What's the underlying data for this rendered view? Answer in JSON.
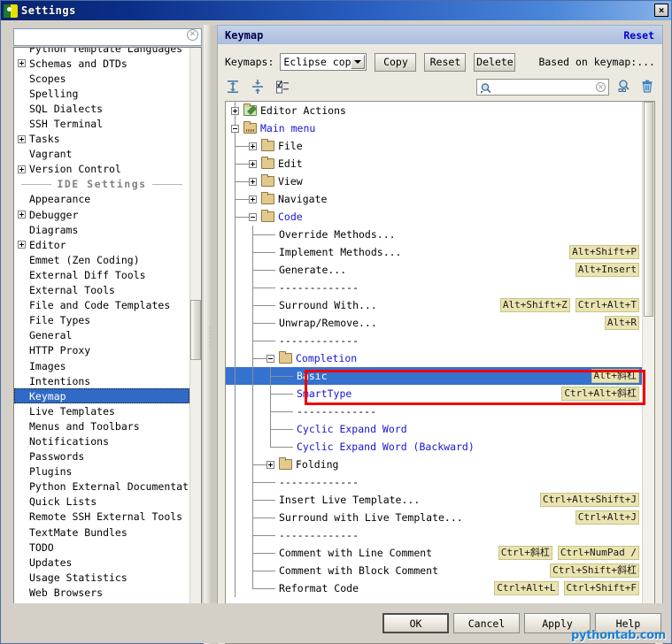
{
  "window": {
    "title": "Settings",
    "close_label": "×",
    "app_icon": "pycharm-icon"
  },
  "sidebar": {
    "search": {
      "value": "",
      "placeholder": "",
      "clear_icon": "clear-icon"
    },
    "items": [
      {
        "label": "Python Template Languages",
        "expandable": false,
        "clipped": true
      },
      {
        "label": "Schemas and DTDs",
        "expandable": true
      },
      {
        "label": "Scopes",
        "expandable": false
      },
      {
        "label": "Spelling",
        "expandable": false
      },
      {
        "label": "SQL Dialects",
        "expandable": false
      },
      {
        "label": "SSH Terminal",
        "expandable": false
      },
      {
        "label": "Tasks",
        "expandable": true
      },
      {
        "label": "Vagrant",
        "expandable": false
      },
      {
        "label": "Version Control",
        "expandable": true
      },
      {
        "label": "IDE Settings",
        "separator": true
      },
      {
        "label": "Appearance",
        "expandable": false
      },
      {
        "label": "Debugger",
        "expandable": true
      },
      {
        "label": "Diagrams",
        "expandable": false
      },
      {
        "label": "Editor",
        "expandable": true
      },
      {
        "label": "Emmet (Zen Coding)",
        "expandable": false
      },
      {
        "label": "External Diff Tools",
        "expandable": false
      },
      {
        "label": "External Tools",
        "expandable": false
      },
      {
        "label": "File and Code Templates",
        "expandable": false
      },
      {
        "label": "File Types",
        "expandable": false
      },
      {
        "label": "General",
        "expandable": false
      },
      {
        "label": "HTTP Proxy",
        "expandable": false
      },
      {
        "label": "Images",
        "expandable": false
      },
      {
        "label": "Intentions",
        "expandable": false
      },
      {
        "label": "Keymap",
        "expandable": false,
        "selected": true
      },
      {
        "label": "Live Templates",
        "expandable": false
      },
      {
        "label": "Menus and Toolbars",
        "expandable": false
      },
      {
        "label": "Notifications",
        "expandable": false
      },
      {
        "label": "Passwords",
        "expandable": false
      },
      {
        "label": "Plugins",
        "expandable": false
      },
      {
        "label": "Python External Documentation",
        "expandable": false
      },
      {
        "label": "Quick Lists",
        "expandable": false
      },
      {
        "label": "Remote SSH External Tools",
        "expandable": false
      },
      {
        "label": "TextMate Bundles",
        "expandable": false
      },
      {
        "label": "TODO",
        "expandable": false
      },
      {
        "label": "Updates",
        "expandable": false
      },
      {
        "label": "Usage Statistics",
        "expandable": false
      },
      {
        "label": "Web Browsers",
        "expandable": false
      }
    ]
  },
  "keymap": {
    "header_title": "Keymap",
    "reset_link": "Reset",
    "keymaps_label": "Keymaps:",
    "selected_keymap": "Eclipse copy",
    "copy_button": "Copy",
    "reset_button": "Reset",
    "delete_button": "Delete",
    "based_on": "Based on keymap:...",
    "toolbar": {
      "expand_all_icon": "expand-all-icon",
      "collapse_all_icon": "collapse-all-icon",
      "show_options_icon": "filter-options-icon",
      "find_icon": "search-icon",
      "find_value": "",
      "find_placeholder": "",
      "find_clear_icon": "clear-icon",
      "find_shortcut_icon": "find-by-shortcut-icon",
      "clear_shortcut_icon": "trash-icon"
    },
    "tree": [
      {
        "id": 0,
        "depth": 0,
        "label": "Editor Actions",
        "toggle": "plus",
        "icon": "folder-editor",
        "blue": false,
        "shortcuts": []
      },
      {
        "id": 1,
        "depth": 0,
        "label": "Main menu",
        "toggle": "minus",
        "icon": "folder-mainmenu",
        "blue": true,
        "shortcuts": []
      },
      {
        "id": 2,
        "depth": 1,
        "label": "File",
        "toggle": "plus",
        "icon": "folder",
        "blue": false,
        "shortcuts": []
      },
      {
        "id": 3,
        "depth": 1,
        "label": "Edit",
        "toggle": "plus",
        "icon": "folder",
        "blue": false,
        "shortcuts": []
      },
      {
        "id": 4,
        "depth": 1,
        "label": "View",
        "toggle": "plus",
        "icon": "folder",
        "blue": false,
        "shortcuts": []
      },
      {
        "id": 5,
        "depth": 1,
        "label": "Navigate",
        "toggle": "plus",
        "icon": "folder",
        "blue": false,
        "shortcuts": []
      },
      {
        "id": 6,
        "depth": 1,
        "label": "Code",
        "toggle": "minus",
        "icon": "folder",
        "blue": true,
        "shortcuts": []
      },
      {
        "id": 7,
        "depth": 2,
        "label": "Override Methods...",
        "toggle": null,
        "icon": null,
        "blue": false,
        "shortcuts": []
      },
      {
        "id": 8,
        "depth": 2,
        "label": "Implement Methods...",
        "toggle": null,
        "icon": null,
        "blue": false,
        "shortcuts": [
          "Alt+Shift+P"
        ]
      },
      {
        "id": 9,
        "depth": 2,
        "label": "Generate...",
        "toggle": null,
        "icon": null,
        "blue": false,
        "shortcuts": [
          "Alt+Insert"
        ]
      },
      {
        "id": 10,
        "depth": 2,
        "label": "-------------",
        "toggle": null,
        "icon": null,
        "blue": false,
        "separator": true,
        "shortcuts": []
      },
      {
        "id": 11,
        "depth": 2,
        "label": "Surround With...",
        "toggle": null,
        "icon": null,
        "blue": false,
        "shortcuts": [
          "Alt+Shift+Z",
          "Ctrl+Alt+T"
        ]
      },
      {
        "id": 12,
        "depth": 2,
        "label": "Unwrap/Remove...",
        "toggle": null,
        "icon": null,
        "blue": false,
        "shortcuts": [
          "Alt+R"
        ]
      },
      {
        "id": 13,
        "depth": 2,
        "label": "-------------",
        "toggle": null,
        "icon": null,
        "blue": false,
        "separator": true,
        "shortcuts": []
      },
      {
        "id": 14,
        "depth": 2,
        "label": "Completion",
        "toggle": "minus",
        "icon": "folder",
        "blue": true,
        "shortcuts": []
      },
      {
        "id": 15,
        "depth": 3,
        "label": "Basic",
        "toggle": null,
        "icon": null,
        "blue": true,
        "selected": true,
        "shortcuts": [
          "Alt+斜杠"
        ]
      },
      {
        "id": 16,
        "depth": 3,
        "label": "SmartType",
        "toggle": null,
        "icon": null,
        "blue": true,
        "shortcuts": [
          "Ctrl+Alt+斜杠"
        ]
      },
      {
        "id": 17,
        "depth": 3,
        "label": "-------------",
        "toggle": null,
        "icon": null,
        "blue": false,
        "separator": true,
        "shortcuts": []
      },
      {
        "id": 18,
        "depth": 3,
        "label": "Cyclic Expand Word",
        "toggle": null,
        "icon": null,
        "blue": true,
        "shortcuts": []
      },
      {
        "id": 19,
        "depth": 3,
        "label": "Cyclic Expand Word (Backward)",
        "toggle": null,
        "icon": null,
        "blue": true,
        "shortcuts": []
      },
      {
        "id": 20,
        "depth": 2,
        "label": "Folding",
        "toggle": "plus",
        "icon": "folder",
        "blue": false,
        "shortcuts": []
      },
      {
        "id": 21,
        "depth": 2,
        "label": "-------------",
        "toggle": null,
        "icon": null,
        "blue": false,
        "separator": true,
        "shortcuts": []
      },
      {
        "id": 22,
        "depth": 2,
        "label": "Insert Live Template...",
        "toggle": null,
        "icon": null,
        "blue": false,
        "shortcuts": [
          "Ctrl+Alt+Shift+J"
        ]
      },
      {
        "id": 23,
        "depth": 2,
        "label": "Surround with Live Template...",
        "toggle": null,
        "icon": null,
        "blue": false,
        "shortcuts": [
          "Ctrl+Alt+J"
        ]
      },
      {
        "id": 24,
        "depth": 2,
        "label": "-------------",
        "toggle": null,
        "icon": null,
        "blue": false,
        "separator": true,
        "shortcuts": []
      },
      {
        "id": 25,
        "depth": 2,
        "label": "Comment with Line Comment",
        "toggle": null,
        "icon": null,
        "blue": false,
        "shortcuts": [
          "Ctrl+斜杠",
          "Ctrl+NumPad /"
        ]
      },
      {
        "id": 26,
        "depth": 2,
        "label": "Comment with Block Comment",
        "toggle": null,
        "icon": null,
        "blue": false,
        "shortcuts": [
          "Ctrl+Shift+斜杠"
        ]
      },
      {
        "id": 27,
        "depth": 2,
        "label": "Reformat Code",
        "toggle": null,
        "icon": null,
        "blue": false,
        "shortcuts": [
          "Ctrl+Alt+L",
          "Ctrl+Shift+F"
        ]
      }
    ]
  },
  "footer": {
    "ok": "OK",
    "cancel": "Cancel",
    "apply": "Apply",
    "help": "Help",
    "watermark": "pythontab.com"
  },
  "colors": {
    "selection_blue": "#3571cf",
    "shortcut_badge": "#e9e4b0",
    "annotation_red": "#ef0000",
    "link_blue": "#0000c8",
    "tree_blue_text": "#1515d0"
  }
}
